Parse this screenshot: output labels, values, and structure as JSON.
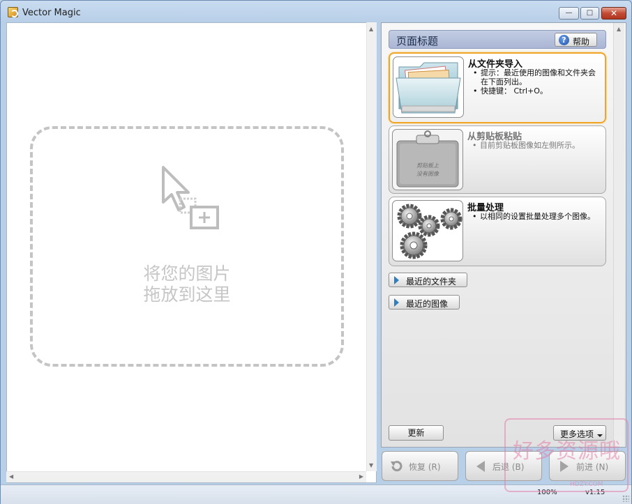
{
  "window": {
    "title": "Vector Magic",
    "min_glyph": "—",
    "max_glyph": "□",
    "close_glyph": "✕"
  },
  "drop_area": {
    "line1": "将您的图片",
    "line2": "拖放到这里",
    "icon": "drag-drop-cursor-icon"
  },
  "panel": {
    "title": "页面标题",
    "help_label": "帮助",
    "help_icon": "question-icon"
  },
  "cards": [
    {
      "title": "从文件夹导入",
      "bullets": [
        "提示：最近使用的图像和文件夹会在下面列出。",
        "快捷键： Ctrl+O。"
      ],
      "icon": "folder-icon",
      "state": "active"
    },
    {
      "title": "从剪贴板粘贴",
      "bullets": [
        "目前剪贴板图像如左侧所示。"
      ],
      "icon": "clipboard-icon",
      "clipboard_text_1": "剪贴板上",
      "clipboard_text_2": "没有图像",
      "state": "disabled"
    },
    {
      "title": "批量处理",
      "bullets": [
        "以相同的设置批量处理多个图像。"
      ],
      "icon": "gears-icon",
      "state": "normal"
    }
  ],
  "recent": {
    "folders_label": "最近的文件夹",
    "images_label": "最近的图像"
  },
  "buttons": {
    "update": "更新",
    "more": "更多选项"
  },
  "nav": {
    "restore": "恢复 (R)",
    "back": "后退 (B)",
    "forward": "前进 (N)"
  },
  "status": {
    "zoom": "100%",
    "version": "v1.15"
  },
  "watermark": {
    "text": "好多资源哦",
    "sub": "HDZY.COM"
  },
  "colors": {
    "active_card_border": "#f0a526",
    "header_bg": "#b3bfdb",
    "play_triangle": "#2e7fbf"
  }
}
